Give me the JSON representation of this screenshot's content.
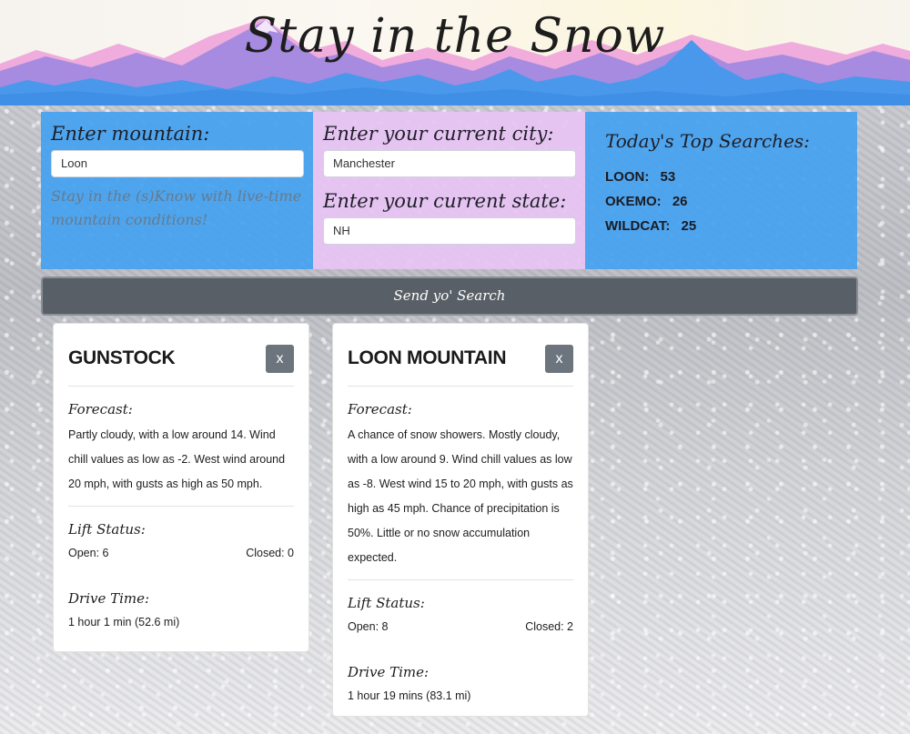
{
  "header": {
    "title": "Stay in the Snow"
  },
  "mountain_panel": {
    "label": "Enter mountain:",
    "value": "Loon",
    "tagline": "Stay in the (s)Know with live-time mountain conditions!"
  },
  "location_panel": {
    "city_label": "Enter your current city:",
    "city_value": "Manchester",
    "state_label": "Enter your current state:",
    "state_value": "NH"
  },
  "top_searches": {
    "title": "Today's Top Searches:",
    "items": [
      {
        "name": "LOON:",
        "count": "53"
      },
      {
        "name": "OKEMO:",
        "count": "26"
      },
      {
        "name": "WILDCAT:",
        "count": "25"
      }
    ]
  },
  "search_button": {
    "label": "Send yo' Search"
  },
  "cards": [
    {
      "title": "GUNSTOCK",
      "close_label": "x",
      "forecast_label": "Forecast:",
      "forecast": "Partly cloudy, with a low around 14. Wind chill values as low as -2. West wind around 20 mph, with gusts as high as 50 mph.",
      "lift_label": "Lift Status:",
      "open": "Open: 6",
      "closed": "Closed: 0",
      "drive_label": "Drive Time:",
      "drive": "1 hour 1 min (52.6 mi)"
    },
    {
      "title": "LOON MOUNTAIN",
      "close_label": "x",
      "forecast_label": "Forecast:",
      "forecast": "A chance of snow showers. Mostly cloudy, with a low around 9. Wind chill values as low as -8. West wind 15 to 20 mph, with gusts as high as 45 mph. Chance of precipitation is 50%. Little or no snow accumulation expected.",
      "lift_label": "Lift Status:",
      "open": "Open: 8",
      "closed": "Closed: 2",
      "drive_label": "Drive Time:",
      "drive": "1 hour 19 mins (83.1 mi)"
    }
  ],
  "colors": {
    "panel_blue": "#44a2f0",
    "panel_pink": "#e8c4f4",
    "button_gray": "#595f66",
    "close_gray": "#6c757d"
  }
}
